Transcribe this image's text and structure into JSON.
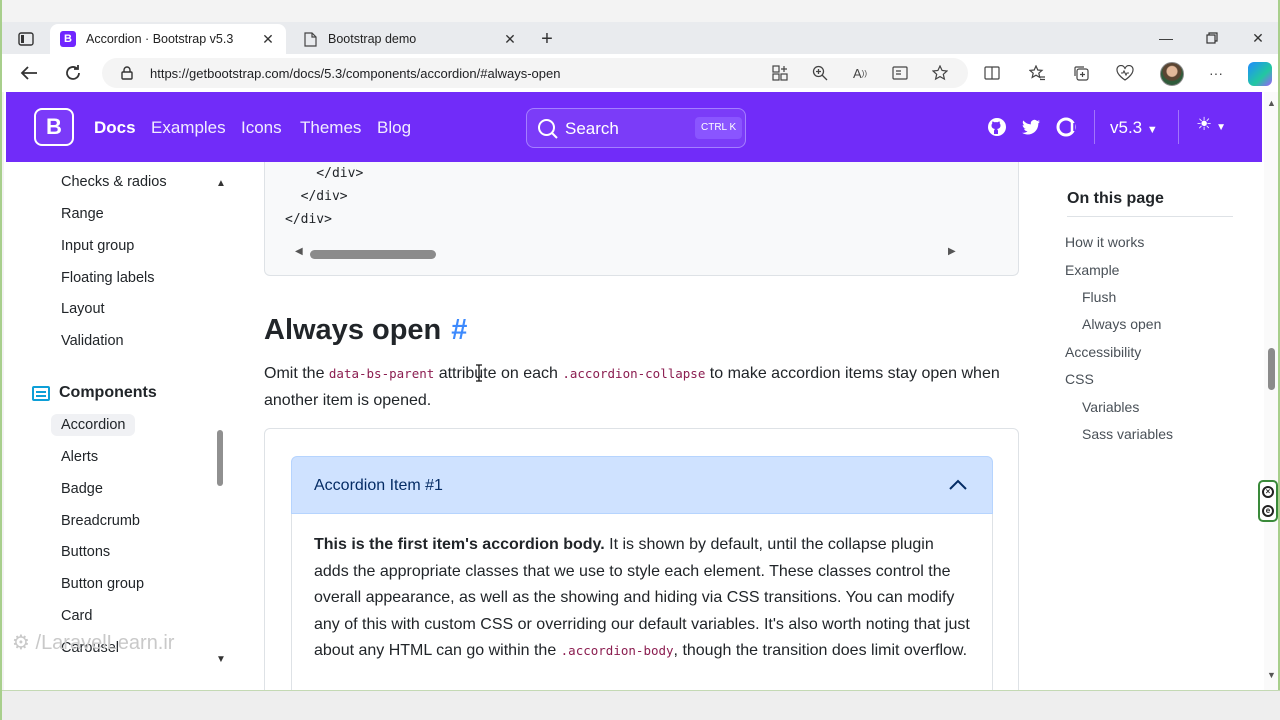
{
  "browser": {
    "tabs": [
      {
        "title": "Accordion · Bootstrap v5.3",
        "active": true,
        "favicon": "bootstrap-logo"
      },
      {
        "title": "Bootstrap demo",
        "active": false,
        "favicon": "page-icon"
      }
    ],
    "url": "https://getbootstrap.com/docs/5.3/components/accordion/#always-open"
  },
  "navbar": {
    "brand_letter": "B",
    "links": [
      "Docs",
      "Examples",
      "Icons",
      "Themes",
      "Blog"
    ],
    "search": {
      "label": "Search",
      "shortcut": "CTRL K"
    },
    "version": "v5.3",
    "brand_color": "#712cf9"
  },
  "sidebar": {
    "items_top": [
      "Checks & radios",
      "Range",
      "Input group",
      "Floating labels",
      "Layout",
      "Validation"
    ],
    "section": "Components",
    "items": [
      "Accordion",
      "Alerts",
      "Badge",
      "Breadcrumb",
      "Buttons",
      "Button group",
      "Card",
      "Carousel"
    ],
    "active_item": "Accordion"
  },
  "watermark": "LaravelLearn.ir",
  "code": {
    "lines": [
      "    </div>",
      "  </div>",
      "</div>"
    ]
  },
  "section": {
    "title": "Always open",
    "anchor": "#",
    "intro_part1": "Omit the ",
    "intro_code1": "data-bs-parent",
    "intro_part2": " attribute on each ",
    "intro_code2": ".accordion-collapse",
    "intro_part3": " to make accordion items stay open when another item is opened."
  },
  "accordion": {
    "item_title": "Accordion Item #1",
    "body_strong": "This is the first item's accordion body.",
    "body_text": " It is shown by default, until the collapse plugin adds the appropriate classes that we use to style each element. These classes control the overall appearance, as well as the showing and hiding via CSS transitions. You can modify any of this with custom CSS or overriding our default variables. It's also worth noting that just about any HTML can go within the ",
    "body_code": ".accordion-body",
    "body_end": ", though the transition does limit overflow."
  },
  "toc": {
    "title": "On this page",
    "links": [
      {
        "label": "How it works",
        "level": 1
      },
      {
        "label": "Example",
        "level": 1
      },
      {
        "label": "Flush",
        "level": 2
      },
      {
        "label": "Always open",
        "level": 2
      },
      {
        "label": "Accessibility",
        "level": 1
      },
      {
        "label": "CSS",
        "level": 1
      },
      {
        "label": "Variables",
        "level": 2
      },
      {
        "label": "Sass variables",
        "level": 2
      }
    ]
  }
}
